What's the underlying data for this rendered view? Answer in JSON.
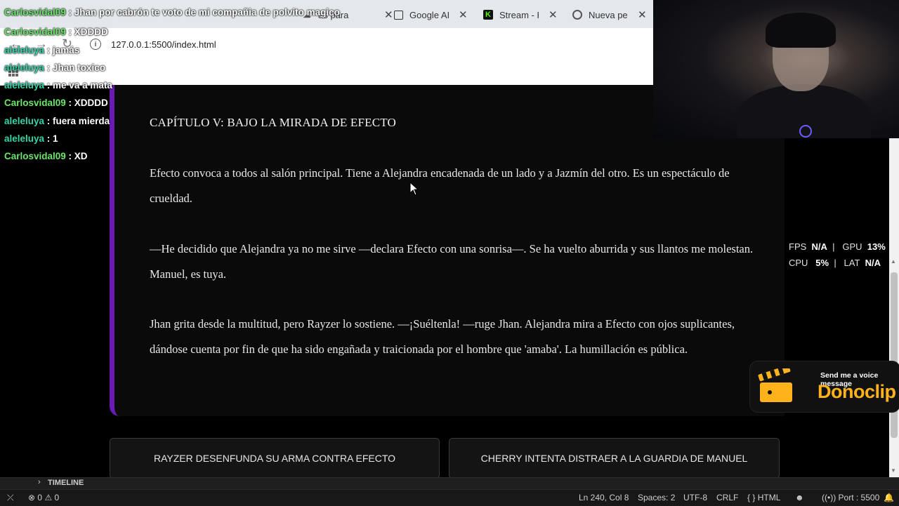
{
  "browser": {
    "tabs": [
      {
        "title": "as para",
        "icon": "cloud-icon"
      },
      {
        "title": "Google AI",
        "icon": "google-ai-icon"
      },
      {
        "title": "Stream - K",
        "icon": "kick-icon"
      },
      {
        "title": "Nueva pes",
        "icon": "chrome-icon"
      }
    ],
    "url": "127.0.0.1:5500/index.html"
  },
  "story": {
    "chapter_title": "CAPÍTULO V: BAJO LA MIRADA DE EFECTO",
    "paragraphs": [
      "Efecto convoca a todos al salón principal. Tiene a Alejandra encadenada de un lado y a Jazmín del otro. Es un espectáculo de crueldad.",
      "—He decidido que Alejandra ya no me sirve —declara Efecto con una sonrisa—. Se ha vuelto aburrida y sus llantos me molestan. Manuel, es tuya.",
      "Jhan grita desde la multitud, pero Rayzer lo sostiene. —¡Suéltenla! —ruge Jhan. Alejandra mira a Efecto con ojos suplicantes, dándose cuenta por fin de que ha sido engañada y traicionada por el hombre que 'amaba'. La humillación es pública."
    ],
    "choices": [
      "RAYZER DESENFUNDA SU ARMA CONTRA EFECTO",
      "CHERRY INTENTA DISTRAER A LA GUARDIA DE MANUEL"
    ]
  },
  "chat": [
    {
      "user": "Carlosvidal09",
      "message": "Jhan por cabrón te voto de mi compañia de polvito magico",
      "color": "green"
    },
    {
      "user": "Carlosvidal09",
      "message": "XDDDD",
      "color": "green"
    },
    {
      "user": "aleleluya",
      "message": "jamás",
      "color": "teal"
    },
    {
      "user": "aleleluya",
      "message": "Jhan toxico",
      "color": "teal"
    },
    {
      "user": "aleleluya",
      "message": "me va a mata",
      "color": "teal"
    },
    {
      "user": "Carlosvidal09",
      "message": "XDDDD",
      "color": "green"
    },
    {
      "user": "aleleluya",
      "message": "fuera mierda",
      "color": "teal"
    },
    {
      "user": "aleleluya",
      "message": "1",
      "color": "teal"
    },
    {
      "user": "Carlosvidal09",
      "message": "XD",
      "color": "green"
    }
  ],
  "perf": {
    "fps_label": "FPS",
    "fps_value": "N/A",
    "gpu_label": "GPU",
    "gpu_value": "13%",
    "cpu_label": "CPU",
    "cpu_value": "5%",
    "lat_label": "LAT",
    "lat_value": "N/A"
  },
  "donoclip": {
    "tagline": "Send me a voice message",
    "brand": "Donoclip"
  },
  "vscode": {
    "timeline_label": "TIMELINE",
    "errors": "0",
    "warnings": "0",
    "position": "Ln 240, Col 8",
    "spaces": "Spaces: 2",
    "encoding": "UTF-8",
    "eol": "CRLF",
    "language": "HTML",
    "port": "Port : 5500"
  },
  "colors": {
    "story_accent": "#6a1bb5",
    "chat_green": "#6be66b",
    "chat_teal": "#37d4a8",
    "donoclip_orange": "#ffb21a"
  }
}
